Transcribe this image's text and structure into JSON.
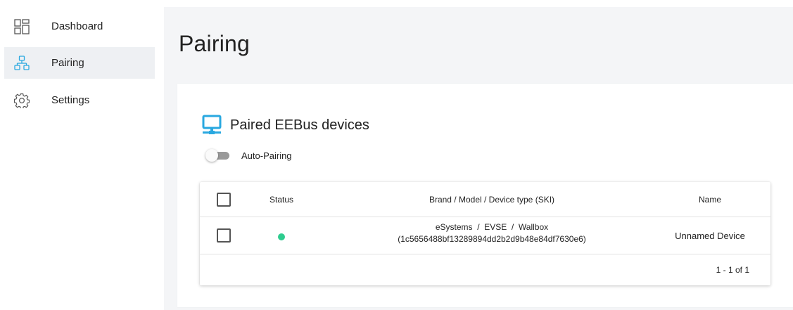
{
  "sidebar": {
    "items": [
      {
        "label": "Dashboard",
        "icon": "dashboard-icon",
        "active": false
      },
      {
        "label": "Pairing",
        "icon": "network-icon",
        "active": true
      },
      {
        "label": "Settings",
        "icon": "gear-icon",
        "active": false
      }
    ]
  },
  "page": {
    "title": "Pairing"
  },
  "card": {
    "title": "Paired EEBus devices",
    "icon": "monitor-network-icon",
    "auto_pairing": {
      "label": "Auto-Pairing",
      "enabled": false
    }
  },
  "table": {
    "headers": {
      "status": "Status",
      "brand": "Brand / Model / Device type (SKI)",
      "name": "Name"
    },
    "rows": [
      {
        "status": "connected",
        "brand_line": "eSystems  /  EVSE  /  Wallbox",
        "ski": "(1c5656488bf13289894dd2b2d9b48e84df7630e6)",
        "name": "Unnamed Device",
        "checked": false
      }
    ],
    "pagination": "1 - 1 of 1"
  },
  "colors": {
    "accent": "#29a8e0",
    "status_ok": "#2ecc8f",
    "active_nav_bg": "#eef0f3",
    "page_bg": "#f4f5f7"
  }
}
